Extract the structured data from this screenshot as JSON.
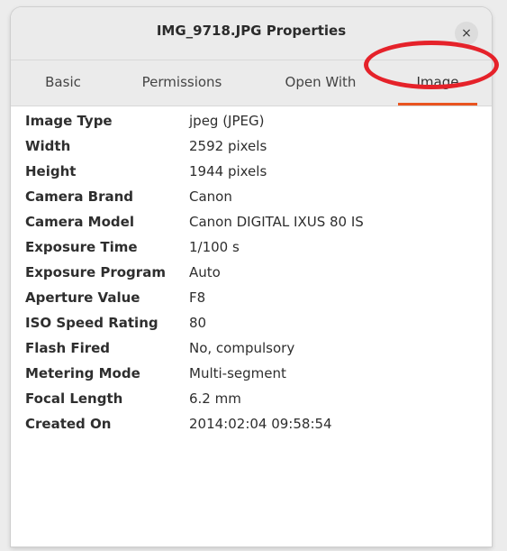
{
  "window": {
    "title": "IMG_9718.JPG Properties",
    "close_label": "×"
  },
  "tabs": [
    {
      "label": "Basic"
    },
    {
      "label": "Permissions"
    },
    {
      "label": "Open With"
    },
    {
      "label": "Image"
    }
  ],
  "selected_tab": "Image",
  "properties": [
    {
      "key": "Image Type",
      "value": "jpeg (JPEG)"
    },
    {
      "key": "Width",
      "value": "2592 pixels"
    },
    {
      "key": "Height",
      "value": "1944 pixels"
    },
    {
      "key": "Camera Brand",
      "value": "Canon"
    },
    {
      "key": "Camera Model",
      "value": "Canon DIGITAL IXUS 80 IS"
    },
    {
      "key": "Exposure Time",
      "value": "1/100 s"
    },
    {
      "key": "Exposure Program",
      "value": "Auto"
    },
    {
      "key": "Aperture Value",
      "value": "F8"
    },
    {
      "key": "ISO Speed Rating",
      "value": "80"
    },
    {
      "key": "Flash Fired",
      "value": "No, compulsory"
    },
    {
      "key": "Metering Mode",
      "value": "Multi-segment"
    },
    {
      "key": "Focal Length",
      "value": "6.2 mm"
    },
    {
      "key": "Created On",
      "value": "2014:02:04 09:58:54"
    }
  ],
  "colors": {
    "accent": "#e95420",
    "annotation": "#e5222a"
  }
}
